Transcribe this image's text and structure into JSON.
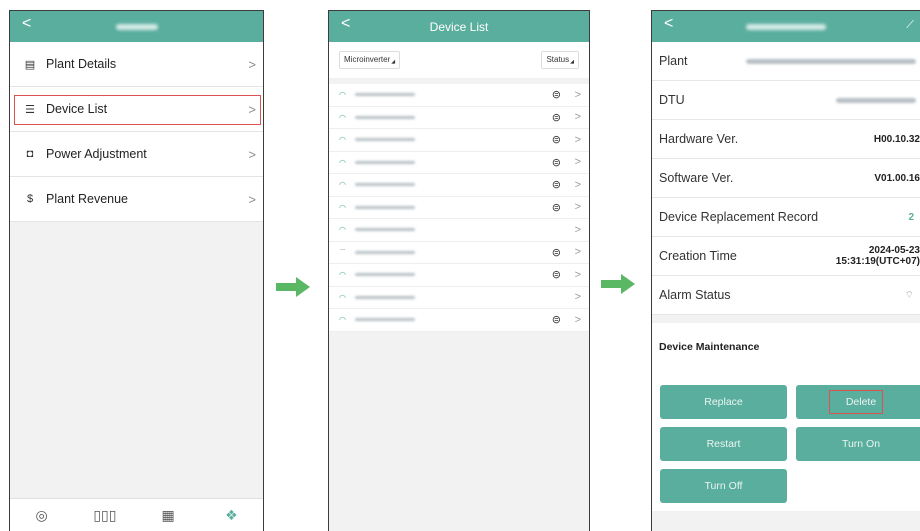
{
  "screen1": {
    "header_title_blurred": true,
    "menu": [
      {
        "label": "Plant Details",
        "icon": "document-icon",
        "glyph": "▤"
      },
      {
        "label": "Device List",
        "icon": "list-icon",
        "glyph": "☰"
      },
      {
        "label": "Power Adjustment",
        "icon": "power-adjust-icon",
        "glyph": "◘"
      },
      {
        "label": "Plant Revenue",
        "icon": "revenue-icon",
        "glyph": "$"
      }
    ],
    "bottom_nav": [
      {
        "icon": "gauge-icon",
        "glyph": "◎"
      },
      {
        "icon": "bar-chart-icon",
        "glyph": "▯▯▯"
      },
      {
        "icon": "solar-panel-icon",
        "glyph": "▦"
      },
      {
        "icon": "devices-icon",
        "glyph": "❖"
      }
    ]
  },
  "screen2": {
    "title": "Device List",
    "filter_type": "Microinverter",
    "filter_status": "Status",
    "devices": [
      {
        "signal": "on",
        "sync": true
      },
      {
        "signal": "on",
        "sync": true
      },
      {
        "signal": "on",
        "sync": true
      },
      {
        "signal": "on",
        "sync": true
      },
      {
        "signal": "on",
        "sync": true
      },
      {
        "signal": "on",
        "sync": true
      },
      {
        "signal": "on",
        "sync": false
      },
      {
        "signal": "off",
        "sync": true
      },
      {
        "signal": "on",
        "sync": true
      },
      {
        "signal": "on",
        "sync": false
      },
      {
        "signal": "on",
        "sync": true
      }
    ]
  },
  "screen3": {
    "rows": [
      {
        "label": "Plant",
        "value": "",
        "blurred": true
      },
      {
        "label": "DTU",
        "value": "",
        "blurred": true
      },
      {
        "label": "Hardware Ver.",
        "value": "H00.10.32"
      },
      {
        "label": "Software Ver.",
        "value": "V01.00.16"
      },
      {
        "label": "Device Replacement Record",
        "value": "2",
        "accent": true
      },
      {
        "label": "Creation Time",
        "value": "2024-05-23\n15:31:19(UTC+07)"
      },
      {
        "label": "Alarm Status",
        "value": "",
        "icon": "no-signal-icon"
      }
    ],
    "maintenance_title": "Device Maintenance",
    "buttons": [
      "Replace",
      "Delete",
      "Restart",
      "Turn On",
      "Turn Off"
    ]
  },
  "colors": {
    "accent": "#5aae9e",
    "highlight": "#d9534f",
    "arrow": "#5ab764"
  }
}
